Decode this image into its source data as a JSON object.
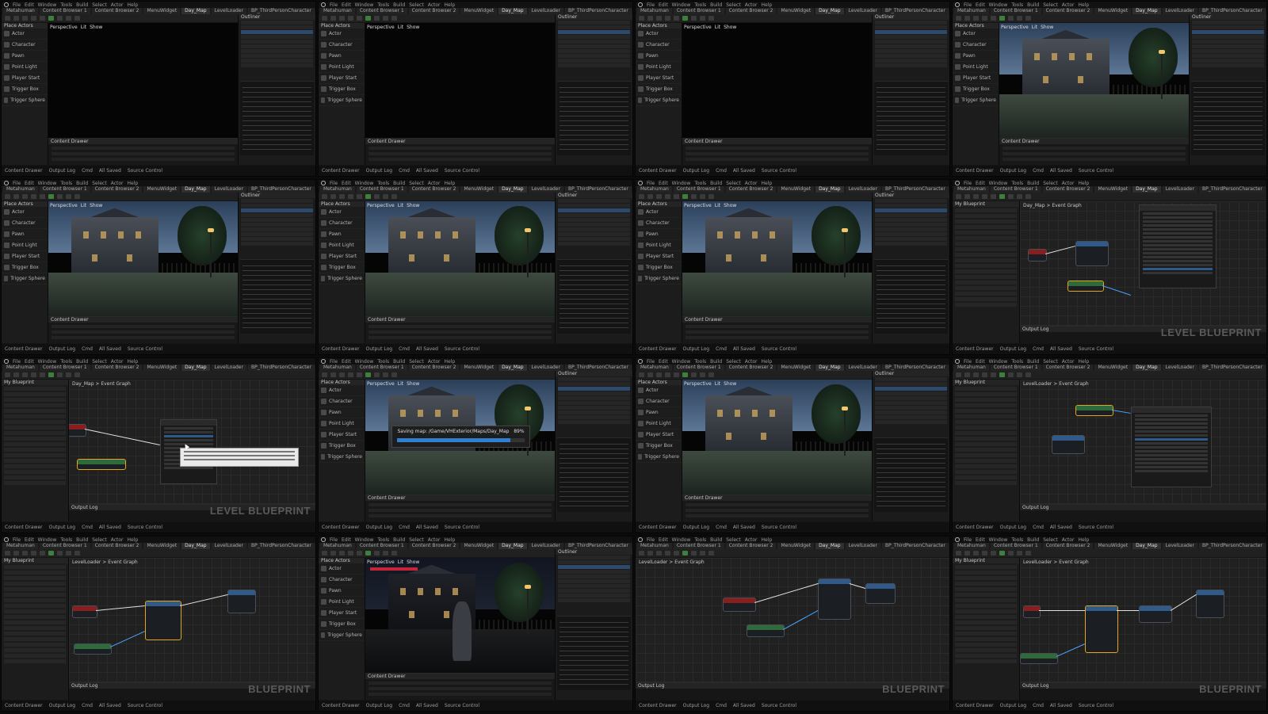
{
  "app": {
    "menu_items": [
      "File",
      "Edit",
      "Window",
      "Tools",
      "Build",
      "Select",
      "Actor",
      "Help"
    ],
    "tabs": [
      "Metahuman",
      "Content Browser 1",
      "Content Browser 2",
      "MenuWidget",
      "Day_Map",
      "LevelLoader",
      "BP_ThirdPersonCharacter"
    ],
    "viewport_labels": [
      "Perspective",
      "Lit",
      "Show"
    ],
    "panels": {
      "place_actors": "Place Actors",
      "outliner": "Outliner",
      "details": "Details",
      "content_drawer": "Content Drawer",
      "output_log": "Output Log",
      "my_blueprint": "My Blueprint"
    },
    "place_items": [
      "Actor",
      "Character",
      "Pawn",
      "Point Light",
      "Player Start",
      "Trigger Box",
      "Trigger Sphere"
    ],
    "status": [
      "Content Drawer",
      "Output Log",
      "Cmd",
      "All Saved",
      "Source Control"
    ]
  },
  "graph": {
    "breadcrumb_level": "Day_Map  >  Event Graph",
    "breadcrumb_loader": "LevelLoader  >  Event Graph"
  },
  "overlays": {
    "level_blueprint": "LEVEL BLUEPRINT",
    "blueprint": "BLUEPRINT"
  },
  "save_dialog": {
    "text": "Saving map: /Game/VHExterior/Maps/Day_Map",
    "percent_label": "89%",
    "progress": 0.89
  }
}
